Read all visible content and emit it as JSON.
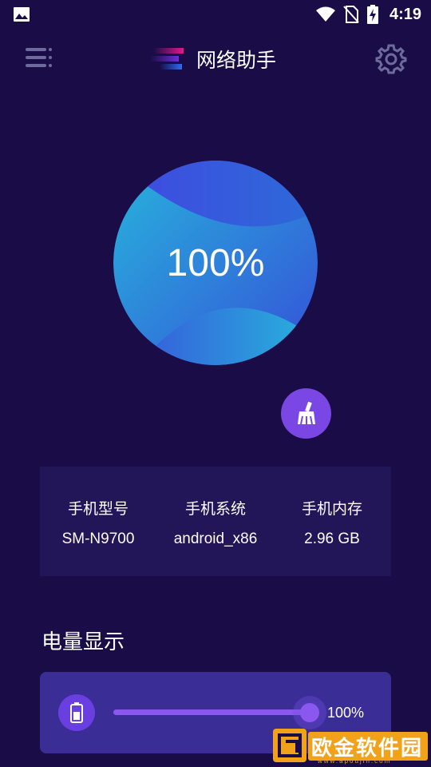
{
  "status_bar": {
    "time": "4:19",
    "icons": [
      "image-icon",
      "wifi-icon",
      "no-sim-icon",
      "battery-charging-icon"
    ]
  },
  "header": {
    "title": "网络助手",
    "menu_icon": "menu-icon",
    "settings_icon": "gear-icon"
  },
  "ball": {
    "percent": "100%",
    "level": 1.0
  },
  "clean_button": {
    "icon": "broom-icon"
  },
  "info": {
    "items": [
      {
        "label": "手机型号",
        "value": "SM-N9700"
      },
      {
        "label": "手机系统",
        "value": "android_x86"
      },
      {
        "label": "手机内存",
        "value": "2.96 GB"
      }
    ]
  },
  "battery": {
    "title": "电量显示",
    "value": "100%",
    "level": 1.0,
    "icon": "battery-icon"
  },
  "watermark": {
    "text": "欧金软件园",
    "sub": "www.apoujin.com"
  },
  "colors": {
    "background": "#1a0c47",
    "card": "#221658",
    "battery_card": "#3a2d96",
    "accent": "#7b47e4",
    "ball_gradient_start": "#2aa8d8",
    "ball_gradient_end": "#3a4fd8"
  }
}
